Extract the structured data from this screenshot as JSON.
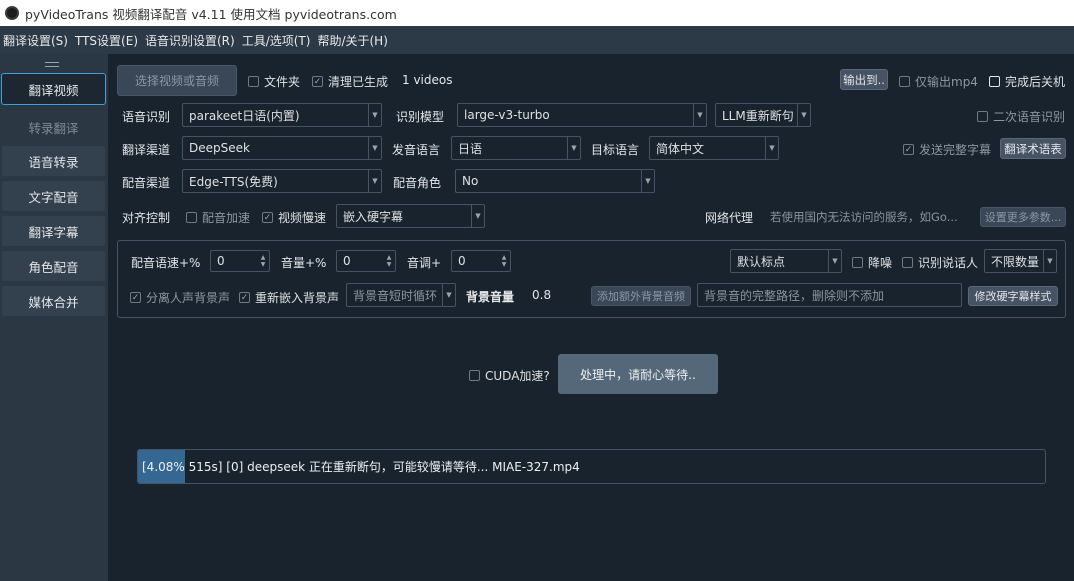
{
  "window": {
    "title": "pyVideoTrans 视频翻译配音 v4.11 使用文档 pyvideotrans.com"
  },
  "menu": [
    {
      "label": "翻译设置(S)"
    },
    {
      "label": "TTS设置(E)"
    },
    {
      "label": "语音识别设置(R)"
    },
    {
      "label": "工具/选项(T)"
    },
    {
      "label": "帮助/关于(H)"
    }
  ],
  "sidebar": {
    "items": [
      {
        "label": "翻译视频"
      },
      {
        "label": "转录翻译"
      },
      {
        "label": "语音转录"
      },
      {
        "label": "文字配音"
      },
      {
        "label": "翻译字幕"
      },
      {
        "label": "角色配音"
      },
      {
        "label": "媒体合并"
      }
    ]
  },
  "toolbar": {
    "select_button": "选择视频或音频",
    "folder_checkbox": "文件夹",
    "clear_checkbox": "清理已生成",
    "video_count": "1 videos",
    "output_button": "输出到..",
    "mp4_only": "仅输出mp4",
    "shutdown": "完成后关机"
  },
  "row_asr": {
    "label": "语音识别",
    "engine": "parakeet日语(内置)",
    "model_label": "识别模型",
    "model": "large-v3-turbo",
    "resplit": "LLM重新断句",
    "second_asr": "二次语音识别"
  },
  "row_translate": {
    "label": "翻译渠道",
    "channel": "DeepSeek",
    "source_label": "发音语言",
    "source": "日语",
    "target_label": "目标语言",
    "target": "简体中文",
    "send_full": "发送完整字幕",
    "terms_button": "翻译术语表"
  },
  "row_dub": {
    "label": "配音渠道",
    "channel": "Edge-TTS(免费)",
    "role_label": "配音角色",
    "role": "No"
  },
  "row_align": {
    "label": "对齐控制",
    "speedup": "配音加速",
    "slowdown": "视频慢速",
    "subtitle_mode": "嵌入硬字幕",
    "proxy_label": "网络代理",
    "proxy_placeholder": "若使用国内无法访问的服务，如Go...",
    "more_params": "设置更多参数..."
  },
  "params": {
    "rate_label": "配音语速+%",
    "rate_value": "0",
    "volume_label": "音量+%",
    "volume_value": "0",
    "pitch_label": "音调+",
    "pitch_value": "0",
    "punct": "默认标点",
    "denoise": "降噪",
    "speaker_id": "识别说话人",
    "speaker_count": "不限数量",
    "separate_bg": "分离人声背景声",
    "reembed_bg": "重新嵌入背景声",
    "bg_mode": "背景音短时循环",
    "bg_volume_label": "背景音量",
    "bg_volume_value": "0.8",
    "add_bg_button": "添加额外背景音频",
    "bg_path_placeholder": "背景音的完整路径，删除则不添加",
    "subtitle_style_button": "修改硬字幕样式"
  },
  "cuda_label": "CUDA加速?",
  "process_button": "处理中，请耐心等待..",
  "progress": {
    "fraction": 0.0408,
    "text": "[4.08%   515s]  [0] deepseek 正在重新断句，可能较慢请等待... MIAE-327.mp4"
  }
}
